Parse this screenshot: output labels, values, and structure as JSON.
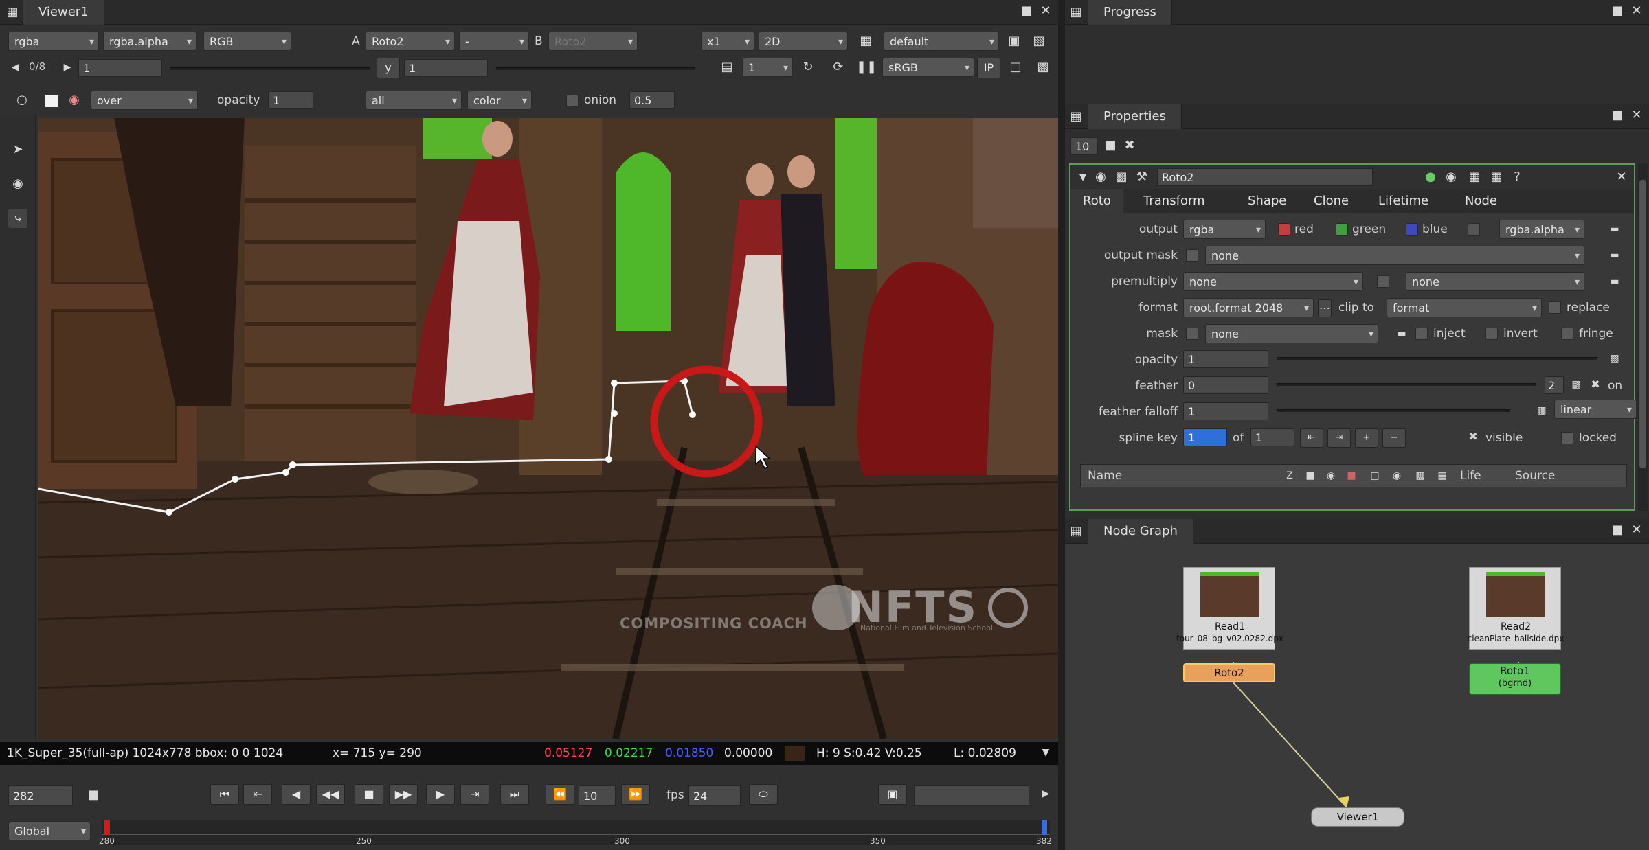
{
  "viewer": {
    "tab": "Viewer1",
    "channels": "rgba",
    "alpha": "rgba.alpha",
    "display": "RGB",
    "a_label": "A",
    "input_a": "Roto2",
    "op": "-",
    "b_label": "B",
    "input_b": "Roto2",
    "zoom": "x1",
    "mode": "2D",
    "lut": "default",
    "frame_step": "0/8",
    "gain": "1",
    "y_label": "y",
    "gamma": "1",
    "proxy": "1",
    "colorspace": "sRGB",
    "ip_label": "IP",
    "wipe": "over",
    "opacity_label": "opacity",
    "opacity": "1",
    "layer": "all",
    "compare": "color",
    "onion_label": "onion",
    "onion": "0.5",
    "watermark_brand": "NFTS",
    "watermark_sub": "COMPOSITING COACH",
    "watermark_small": "National Film and Television School"
  },
  "info_bar": {
    "format": "1K_Super_35(full-ap) 1024x778 bbox: 0 0 1024",
    "coords": "x= 715 y= 290",
    "r": "0.05127",
    "g": "0.02217",
    "b": "0.01850",
    "a": "0.00000",
    "hsv": "H:  9 S:0.42 V:0.25",
    "lum": "L: 0.02809",
    "r_color": "#ff4a4a",
    "g_color": "#3ddc3d",
    "b_color": "#4a5cff"
  },
  "timeline": {
    "frame": "282",
    "increment": "10",
    "fps_label": "fps",
    "fps": "24",
    "range": "Global",
    "ticks": [
      "280",
      "250",
      "300",
      "350",
      "382"
    ]
  },
  "progress": {
    "tab": "Progress"
  },
  "properties": {
    "tab": "Properties",
    "max_panels": "10",
    "node_name": "Roto2",
    "tabs": [
      "Roto",
      "Transform",
      "Shape",
      "Clone",
      "Lifetime",
      "Node"
    ],
    "output_label": "output",
    "output": "rgba",
    "red": "red",
    "green": "green",
    "blue": "blue",
    "alpha_ch": "rgba.alpha",
    "output_mask_label": "output mask",
    "output_mask": "none",
    "premultiply_label": "premultiply",
    "premultiply": "none",
    "premultiply2": "none",
    "format_label": "format",
    "format": "root.format 2048",
    "clip_to_label": "clip to",
    "clip_to": "format",
    "replace": "replace",
    "mask_label": "mask",
    "mask": "none",
    "inject": "inject",
    "invert": "invert",
    "fringe": "fringe",
    "opacity_label": "opacity",
    "opacity": "1",
    "feather_label": "feather",
    "feather": "0",
    "feather_count": "2",
    "on": "on",
    "falloff_label": "feather falloff",
    "falloff": "1",
    "falloff_type": "linear",
    "spline_key_label": "spline key",
    "spline_key": "1",
    "of": "of",
    "spline_total": "1",
    "visible": "visible",
    "locked": "locked",
    "col_name": "Name",
    "col_life": "Life",
    "col_source": "Source"
  },
  "node_graph": {
    "tab": "Node Graph",
    "read1": "Read1",
    "read1_file": "tour_08_bg_v02.0282.dpx",
    "roto2": "Roto2",
    "read2": "Read2",
    "read2_file": "cleanPlate_hallside.dpx",
    "roto1": "Roto1",
    "roto1_sub": "(bgrnd)",
    "viewer": "Viewer1"
  }
}
